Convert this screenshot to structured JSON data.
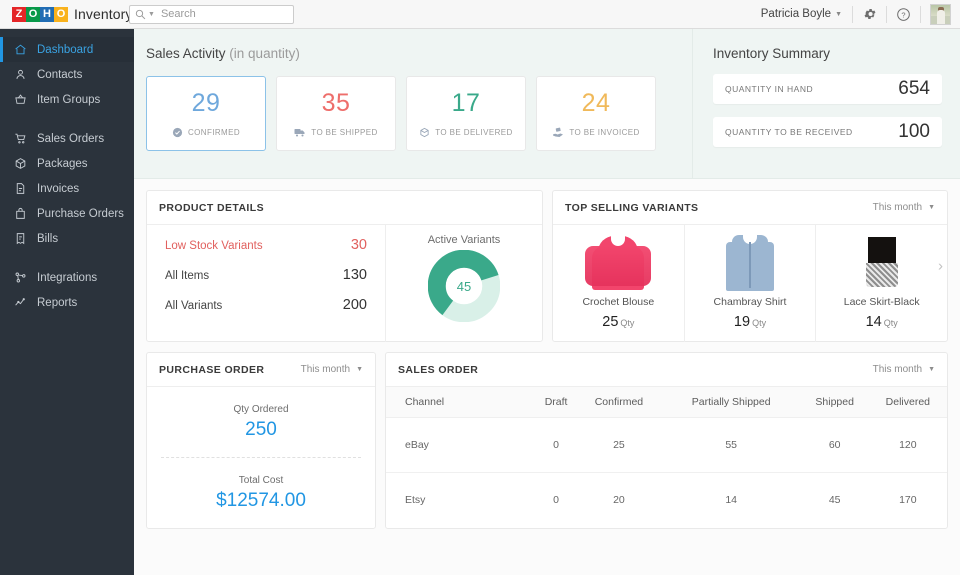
{
  "topbar": {
    "logo_letters": [
      "Z",
      "O",
      "H",
      "O"
    ],
    "app_name": "Inventory",
    "search_placeholder": "Search",
    "search_value": "",
    "user_name": "Patricia Boyle",
    "gear_icon": "gear-icon",
    "help_icon": "help-icon",
    "avatar": "user-avatar"
  },
  "sidebar": {
    "items": [
      {
        "label": "Dashboard",
        "icon": "home-icon",
        "active": true
      },
      {
        "label": "Contacts",
        "icon": "user-icon",
        "active": false
      },
      {
        "label": "Item Groups",
        "icon": "basket-icon",
        "active": false
      },
      {
        "label": "Sales Orders",
        "icon": "cart-icon",
        "active": false
      },
      {
        "label": "Packages",
        "icon": "package-icon",
        "active": false
      },
      {
        "label": "Invoices",
        "icon": "invoice-icon",
        "active": false
      },
      {
        "label": "Purchase Orders",
        "icon": "bag-icon",
        "active": false
      },
      {
        "label": "Bills",
        "icon": "bill-icon",
        "active": false
      },
      {
        "label": "Integrations",
        "icon": "integrations-icon",
        "active": false
      },
      {
        "label": "Reports",
        "icon": "reports-icon",
        "active": false
      }
    ]
  },
  "sales_activity": {
    "title": "Sales Activity",
    "subtitle": "(in quantity)",
    "cards": [
      {
        "value": "29",
        "label": "CONFIRMED",
        "color": "#6fa8dc",
        "icon": "check-circle-icon",
        "selected": true
      },
      {
        "value": "35",
        "label": "TO BE SHIPPED",
        "color": "#ee6e6b",
        "icon": "truck-icon",
        "selected": false
      },
      {
        "value": "17",
        "label": "TO BE DELIVERED",
        "color": "#3aa98a",
        "icon": "box-icon",
        "selected": false
      },
      {
        "value": "24",
        "label": "TO BE INVOICED",
        "color": "#f0b95a",
        "icon": "invoice-hand-icon",
        "selected": false
      }
    ]
  },
  "inventory_summary": {
    "title": "Inventory Summary",
    "rows": [
      {
        "label": "QUANTITY IN HAND",
        "value": "654"
      },
      {
        "label": "QUANTITY TO BE RECEIVED",
        "value": "100"
      }
    ]
  },
  "product_details": {
    "title": "PRODUCT DETAILS",
    "lines": [
      {
        "name": "Low Stock Variants",
        "value": "30",
        "highlight": true
      },
      {
        "name": "All Items",
        "value": "130",
        "highlight": false
      },
      {
        "name": "All Variants",
        "value": "200",
        "highlight": false
      }
    ],
    "chart_data": {
      "type": "pie",
      "title": "Active Variants",
      "categories": [
        "Active Variants",
        "Other Variants"
      ],
      "values": [
        45,
        30
      ],
      "center_label": "45",
      "colors": [
        "#3aa98a",
        "#d9f0e8"
      ],
      "legend": "none"
    }
  },
  "top_selling": {
    "title": "TOP SELLING VARIANTS",
    "period": "This month",
    "next_icon": "chevron-right-icon",
    "items": [
      {
        "name": "Crochet Blouse",
        "qty": "25",
        "unit": "Qty",
        "image": "pink-blouse-image"
      },
      {
        "name": "Chambray Shirt",
        "qty": "19",
        "unit": "Qty",
        "image": "chambray-shirt-image"
      },
      {
        "name": "Lace Skirt-Black",
        "qty": "14",
        "unit": "Qty",
        "image": "black-lace-skirt-image"
      }
    ]
  },
  "purchase_order": {
    "title": "PURCHASE ORDER",
    "period": "This month",
    "blocks": [
      {
        "label": "Qty Ordered",
        "value": "250"
      },
      {
        "label": "Total Cost",
        "value": "$12574.00"
      }
    ]
  },
  "sales_order": {
    "title": "SALES ORDER",
    "period": "This month",
    "columns": [
      "Channel",
      "Draft",
      "Confirmed",
      "Partially Shipped",
      "Shipped",
      "Delivered"
    ],
    "rows": [
      {
        "channel": "eBay",
        "draft": "0",
        "confirmed": "25",
        "partially_shipped": "55",
        "shipped": "60",
        "delivered": "120"
      },
      {
        "channel": "Etsy",
        "draft": "0",
        "confirmed": "20",
        "partially_shipped": "14",
        "shipped": "45",
        "delivered": "170"
      }
    ]
  }
}
